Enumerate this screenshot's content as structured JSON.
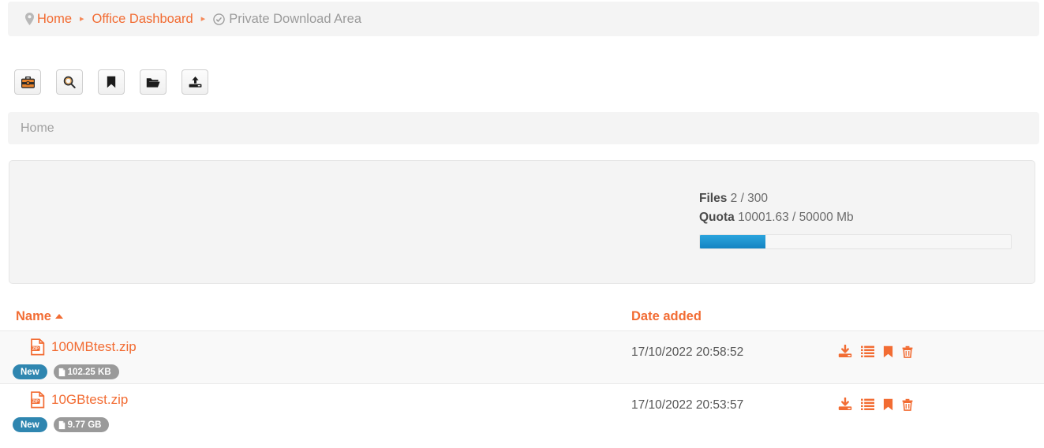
{
  "breadcrumb": {
    "items": [
      {
        "label": "Home",
        "icon": "map-pin-icon",
        "muted": false
      },
      {
        "label": "Office Dashboard",
        "icon": "",
        "muted": false
      },
      {
        "label": "Private Download Area",
        "icon": "check-circle-icon",
        "muted": true
      }
    ],
    "separator": "▸"
  },
  "toolbar": {
    "buttons": [
      {
        "name": "briefcase-button",
        "icon": "briefcase-icon"
      },
      {
        "name": "search-button",
        "icon": "search-icon"
      },
      {
        "name": "bookmark-button",
        "icon": "bookmark-icon"
      },
      {
        "name": "open-folder-button",
        "icon": "folder-open-icon"
      },
      {
        "name": "upload-button",
        "icon": "upload-icon"
      }
    ]
  },
  "path_bar": {
    "current_path": "Home"
  },
  "quota_panel": {
    "files_label": "Files",
    "files_value": "2 / 300",
    "quota_label": "Quota",
    "quota_value": "10001.63 / 50000 Mb",
    "progress_percent": 21,
    "progress_color": "#1e95d0"
  },
  "table": {
    "columns": [
      {
        "key": "name",
        "label": "Name",
        "sort": "asc"
      },
      {
        "key": "date_added",
        "label": "Date added",
        "sort": "none"
      }
    ],
    "rows": [
      {
        "filename": "100MBtest.zip",
        "file_type": "zip",
        "badge_new": "New",
        "size": "102.25 KB",
        "date_added": "17/10/2022 20:58:52",
        "actions": [
          "download-icon",
          "details-icon",
          "bookmark-icon",
          "delete-icon"
        ]
      },
      {
        "filename": "10GBtest.zip",
        "file_type": "zip",
        "badge_new": "New",
        "size": "9.77 GB",
        "date_added": "17/10/2022 20:53:57",
        "actions": [
          "download-icon",
          "details-icon",
          "bookmark-icon",
          "delete-icon"
        ]
      }
    ]
  },
  "colors": {
    "accent_orange": "#f26c33",
    "badge_blue": "#2f86b0",
    "badge_gray": "#9a9a9a",
    "panel_gray": "#f4f4f4"
  }
}
